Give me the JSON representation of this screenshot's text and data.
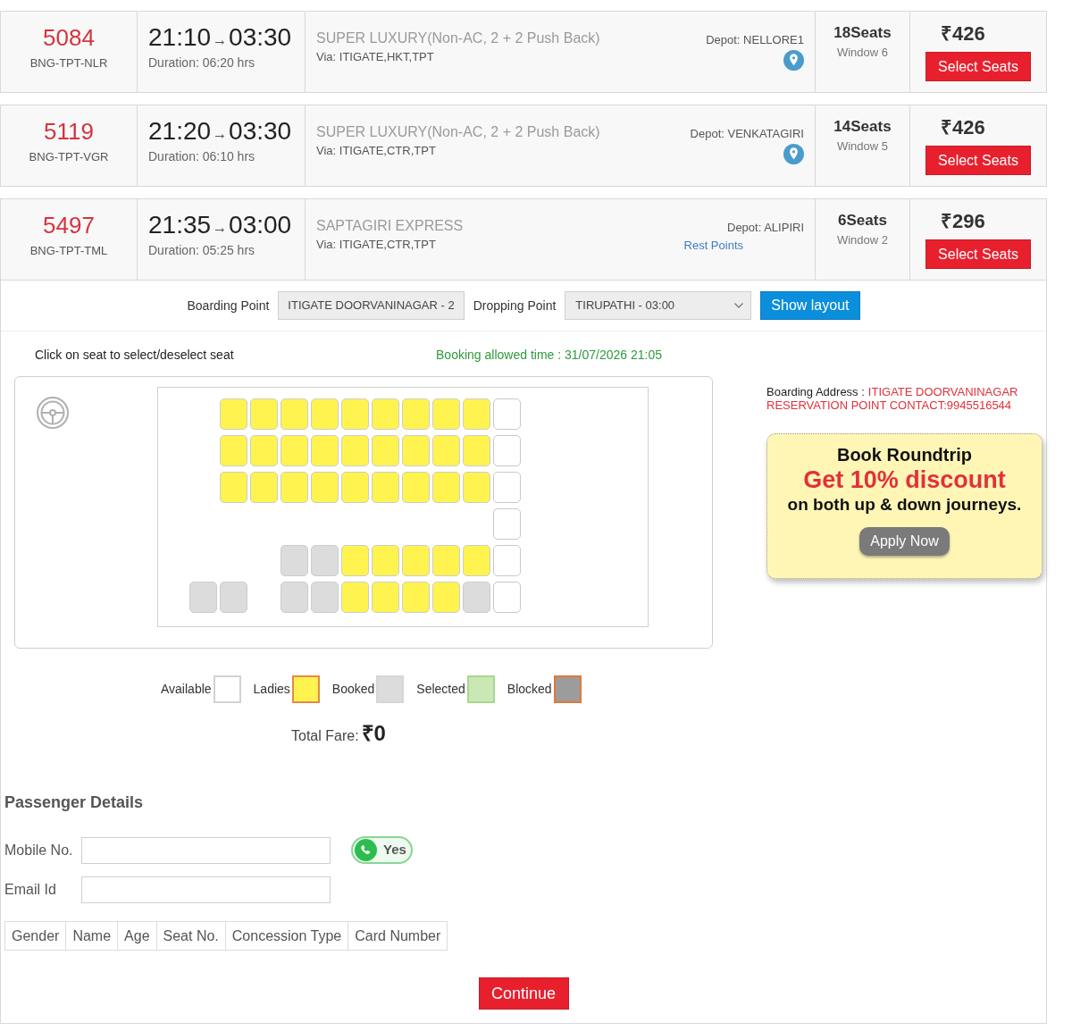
{
  "buses": [
    {
      "number": "5084",
      "route": "BNG-TPT-NLR",
      "departure": "21:10",
      "arrival": "03:30",
      "duration": "Duration: 06:20 hrs",
      "service": "SUPER LUXURY(Non-AC, 2 + 2 Push Back)",
      "via": "Via: ITIGATE,HKT,TPT",
      "depot": "Depot: NELLORE1",
      "location_pin": true,
      "seats": "18Seats",
      "window": "Window 6",
      "fare": "₹426",
      "button": "Select Seats"
    },
    {
      "number": "5119",
      "route": "BNG-TPT-VGR",
      "departure": "21:20",
      "arrival": "03:30",
      "duration": "Duration: 06:10 hrs",
      "service": "SUPER LUXURY(Non-AC, 2 + 2 Push Back)",
      "via": "Via: ITIGATE,CTR,TPT",
      "depot": "Depot: VENKATAGIRI",
      "location_pin": true,
      "seats": "14Seats",
      "window": "Window 5",
      "fare": "₹426",
      "button": "Select Seats"
    },
    {
      "number": "5497",
      "route": "BNG-TPT-TML",
      "departure": "21:35",
      "arrival": "03:00",
      "duration": "Duration: 05:25 hrs",
      "service": "SAPTAGIRI EXPRESS",
      "via": "Via: ITIGATE,CTR,TPT",
      "depot": "Depot: ALIPIRI",
      "location_pin": false,
      "rest_points": "Rest Points",
      "seats": "6Seats",
      "window": "Window 2",
      "fare": "₹296",
      "button": "Select Seats"
    }
  ],
  "journey_bar": {
    "boarding_label": "Boarding Point",
    "boarding_value": "ITIGATE DOORVANINAGAR - 2",
    "dropping_label": "Dropping Point",
    "dropping_value": "TIRUPATHI - 03:00",
    "button": "Show layout"
  },
  "seat_map": {
    "instruction": "Click on seat to select/deselect seat",
    "booking_time": "Booking allowed time : 31/07/2026 21:05",
    "rows": [
      [
        null,
        {
          "kind": "ladies"
        },
        {
          "kind": "ladies"
        },
        {
          "kind": "ladies"
        },
        {
          "kind": "ladies"
        },
        {
          "kind": "ladies"
        },
        {
          "kind": "ladies"
        },
        {
          "kind": "ladies"
        },
        {
          "kind": "ladies"
        },
        {
          "kind": "ladies"
        },
        {
          "kind": "available"
        }
      ],
      [
        null,
        {
          "kind": "ladies"
        },
        {
          "kind": "ladies"
        },
        {
          "kind": "ladies"
        },
        {
          "kind": "ladies"
        },
        {
          "kind": "ladies"
        },
        {
          "kind": "ladies"
        },
        {
          "kind": "ladies"
        },
        {
          "kind": "ladies"
        },
        {
          "kind": "ladies"
        },
        {
          "kind": "available"
        }
      ],
      [
        null,
        {
          "kind": "ladies"
        },
        {
          "kind": "ladies"
        },
        {
          "kind": "ladies"
        },
        {
          "kind": "ladies"
        },
        {
          "kind": "ladies"
        },
        {
          "kind": "ladies"
        },
        {
          "kind": "ladies"
        },
        {
          "kind": "ladies"
        },
        {
          "kind": "ladies"
        },
        {
          "kind": "available"
        }
      ],
      [
        null,
        null,
        null,
        null,
        null,
        null,
        null,
        null,
        null,
        null,
        {
          "kind": "available"
        }
      ],
      [
        null,
        null,
        null,
        {
          "kind": "booked"
        },
        {
          "kind": "booked"
        },
        {
          "kind": "ladies"
        },
        {
          "kind": "ladies"
        },
        {
          "kind": "ladies"
        },
        {
          "kind": "ladies"
        },
        {
          "kind": "ladies"
        },
        {
          "kind": "available"
        }
      ],
      [
        {
          "kind": "booked"
        },
        {
          "kind": "booked"
        },
        null,
        {
          "kind": "booked"
        },
        {
          "kind": "booked"
        },
        {
          "kind": "ladies"
        },
        {
          "kind": "ladies"
        },
        {
          "kind": "ladies"
        },
        {
          "kind": "ladies"
        },
        {
          "kind": "booked"
        },
        {
          "kind": "available"
        }
      ]
    ]
  },
  "legend": [
    {
      "label": "Available",
      "kind": "available"
    },
    {
      "label": "Ladies",
      "kind": "ladies"
    },
    {
      "label": "Booked",
      "kind": "booked"
    },
    {
      "label": "Selected",
      "kind": "selected"
    },
    {
      "label": "Blocked",
      "kind": "blocked"
    }
  ],
  "total_fare": {
    "label": "Total Fare:",
    "value": "₹0"
  },
  "boarding_address": {
    "label": "Boarding Address :",
    "lines": [
      "ITIGATE DOORVANINAGAR",
      "RESERVATION POINT CONTACT:9945516544"
    ]
  },
  "promo": {
    "title": "Book Roundtrip",
    "highlight": "Get 10% discount",
    "subtitle": "on both up & down journeys.",
    "button": "Apply Now"
  },
  "passenger_details": {
    "title": "Passenger Details",
    "fields": [
      {
        "label": "Mobile No.",
        "whatsapp_button": {
          "label": "Yes",
          "selected": true
        }
      },
      {
        "label": "Email Id"
      }
    ],
    "columns": [
      "Gender",
      "Name",
      "Age",
      "Seat No.",
      "Concession Type",
      "Card Number"
    ]
  },
  "continue_button": "Continue"
}
